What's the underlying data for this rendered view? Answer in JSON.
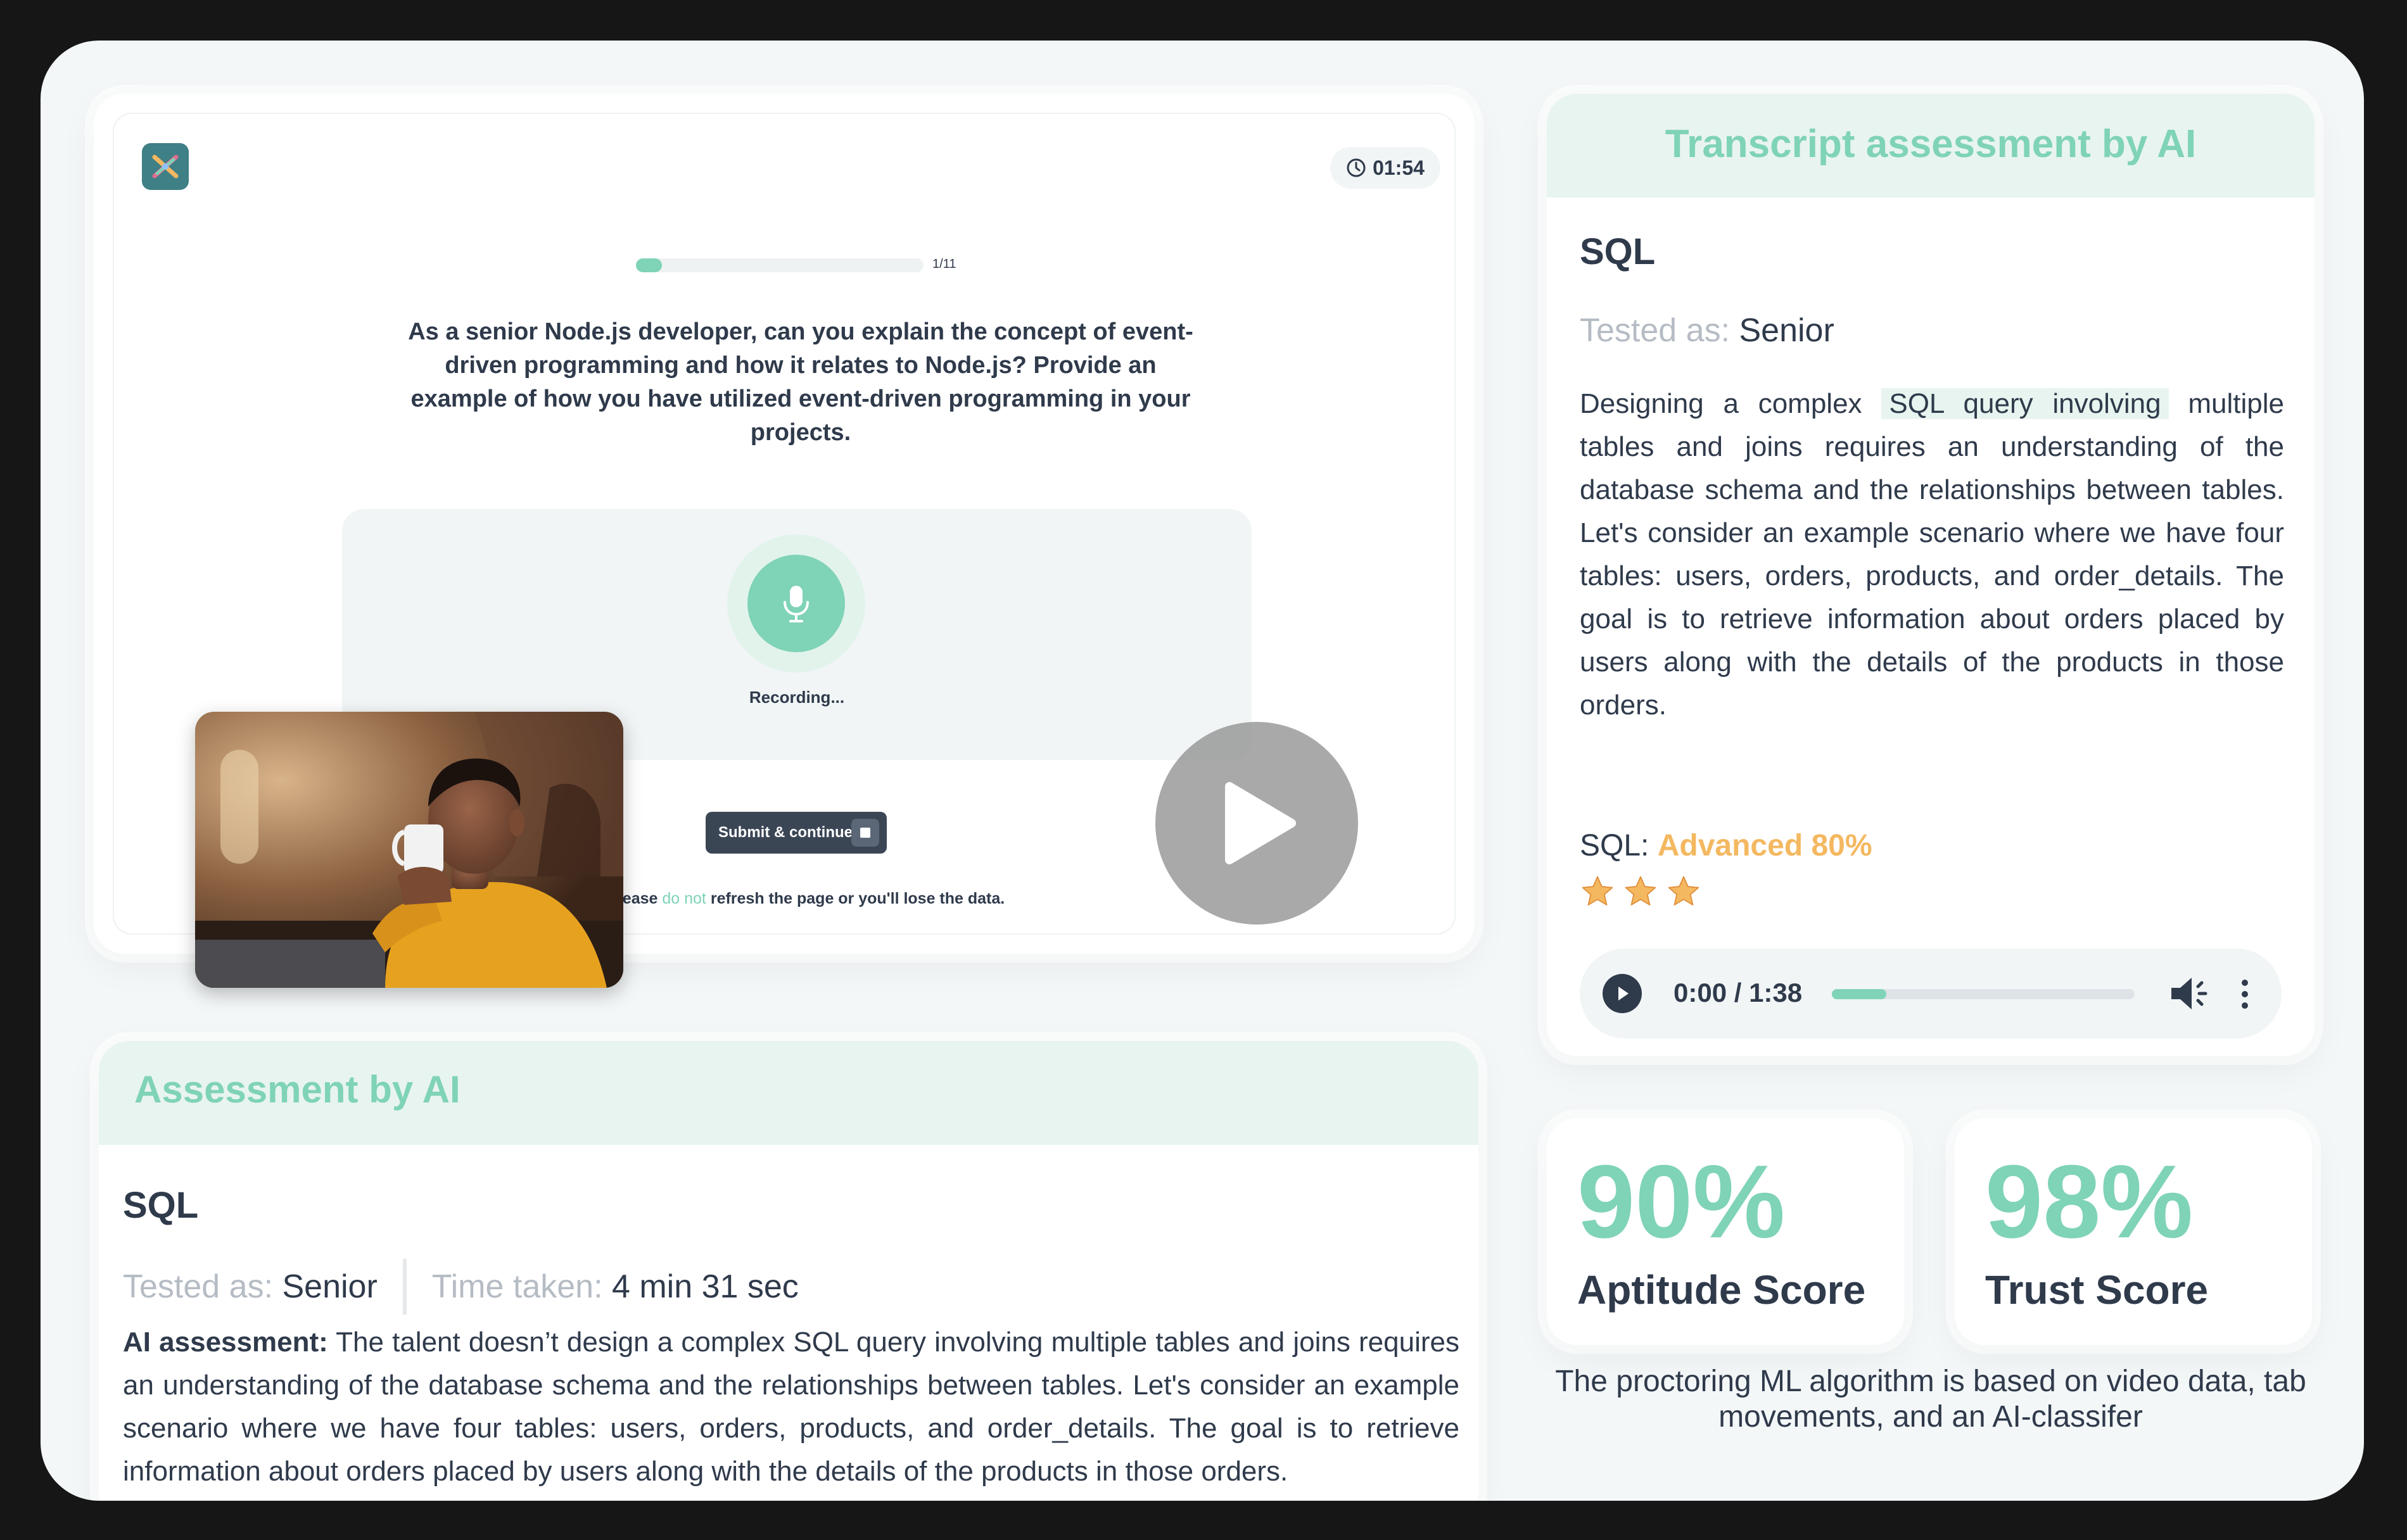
{
  "recorder": {
    "timer": "01:54",
    "progress_label": "1/11",
    "progress_fraction": 0.09,
    "question": "As a senior Node.js developer, can you explain the concept of event-driven programming and how it relates to Node.js? Provide an example of how you have utilized event-driven programming in your projects.",
    "recording_label": "Recording...",
    "submit_label": "Submit & continue",
    "note_prefix": "Note: please ",
    "note_highlight": "do not",
    "note_suffix": " refresh the page or you'll lose the data."
  },
  "assessment": {
    "title": "Assessment by AI",
    "skill": "SQL",
    "tested_as_label": "Tested as:",
    "tested_as_value": "Senior",
    "time_label": "Time taken:",
    "time_value": "4 min 31 sec",
    "ai_label": "AI assessment:",
    "ai_text": "The talent doesn’t design a complex SQL query involving multiple tables and joins requires an understanding of the database schema and the relationships between tables. Let's consider an example scenario where we have four tables: users, orders, products, and order_details. The goal is to retrieve information about orders placed by users along with the details of the products in those orders."
  },
  "transcript": {
    "title": "Transcript assessment by AI",
    "skill": "SQL",
    "tested_as_label": "Tested as:",
    "tested_as_value": "Senior",
    "text_before": "Designing a complex ",
    "text_highlight": "SQL query involving",
    "text_after": " multiple tables and joins requires an understanding of the database schema and the relationships between tables. Let's consider an example scenario where we have four tables: users, orders, products, and order_details. The goal is to retrieve information about orders placed by users along with the details of the products in those orders.",
    "level_label": "SQL:",
    "level_value": "Advanced 80%",
    "stars": 3,
    "audio_time": "0:00 / 1:38",
    "audio_progress_fraction": 0.18
  },
  "scores": {
    "aptitude_value": "90%",
    "aptitude_label": "Aptitude Score",
    "trust_value": "98%",
    "trust_label": "Trust Score"
  },
  "proctor_note": "The proctoring ML algorithm is based on video data, tab movements, and an AI-classifer",
  "colors": {
    "accent": "#7fd3b6",
    "warning": "#f4b860",
    "text": "#2f3a4b",
    "muted": "#b6bcc4"
  }
}
